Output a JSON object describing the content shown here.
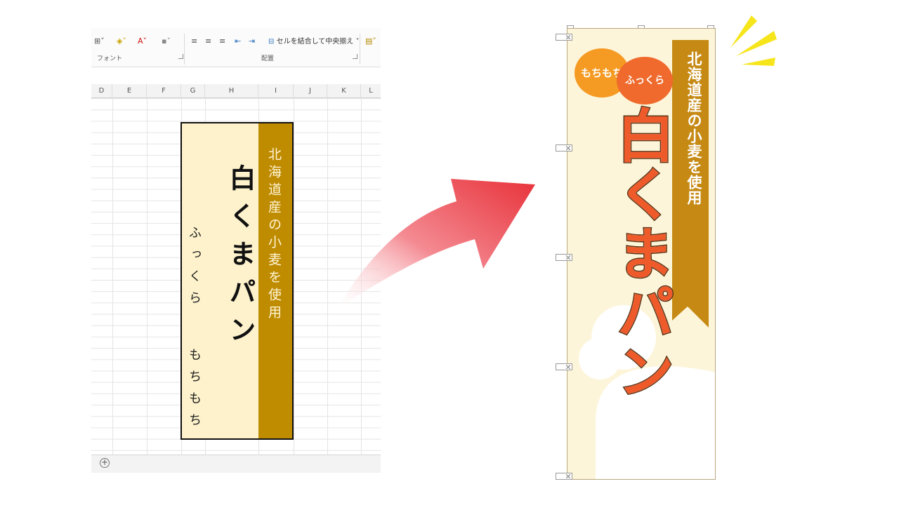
{
  "excel": {
    "ribbon": {
      "font_group": "フォント",
      "align_group": "配置",
      "merge_button": "セルを結合して中央揃え",
      "icons": [
        "borders-icon",
        "fill-color-icon",
        "font-color-icon",
        "phonetic-icon",
        "align-left-icon",
        "align-center-icon",
        "align-right-icon",
        "indent-decrease-icon",
        "indent-increase-icon",
        "merge-icon",
        "number-format-icon"
      ]
    },
    "columns": [
      "D",
      "E",
      "F",
      "G",
      "H",
      "I",
      "J",
      "K",
      "L"
    ],
    "add_sheet_symbol": "+",
    "banner": {
      "subtitle": "北海道産の小麦を使用",
      "title": "白くまパン",
      "phrase1": "ふっくら",
      "phrase2": "もちもち",
      "strip_color": "#bf8c00",
      "background_color": "#fdf2cc"
    }
  },
  "nobori": {
    "subtitle": "北海道産の小麦を使用",
    "title": "白くまパン",
    "bubble1": "もちもち",
    "bubble2": "ふっくら",
    "title_color": "#ef5a2a",
    "strip_color": "#c68a14",
    "bubble1_color": "#f59a22",
    "bubble2_color": "#ef6a2c"
  },
  "decorations": {
    "arrow_color": "#e8323a",
    "sparks_color": "#f7e51c"
  }
}
